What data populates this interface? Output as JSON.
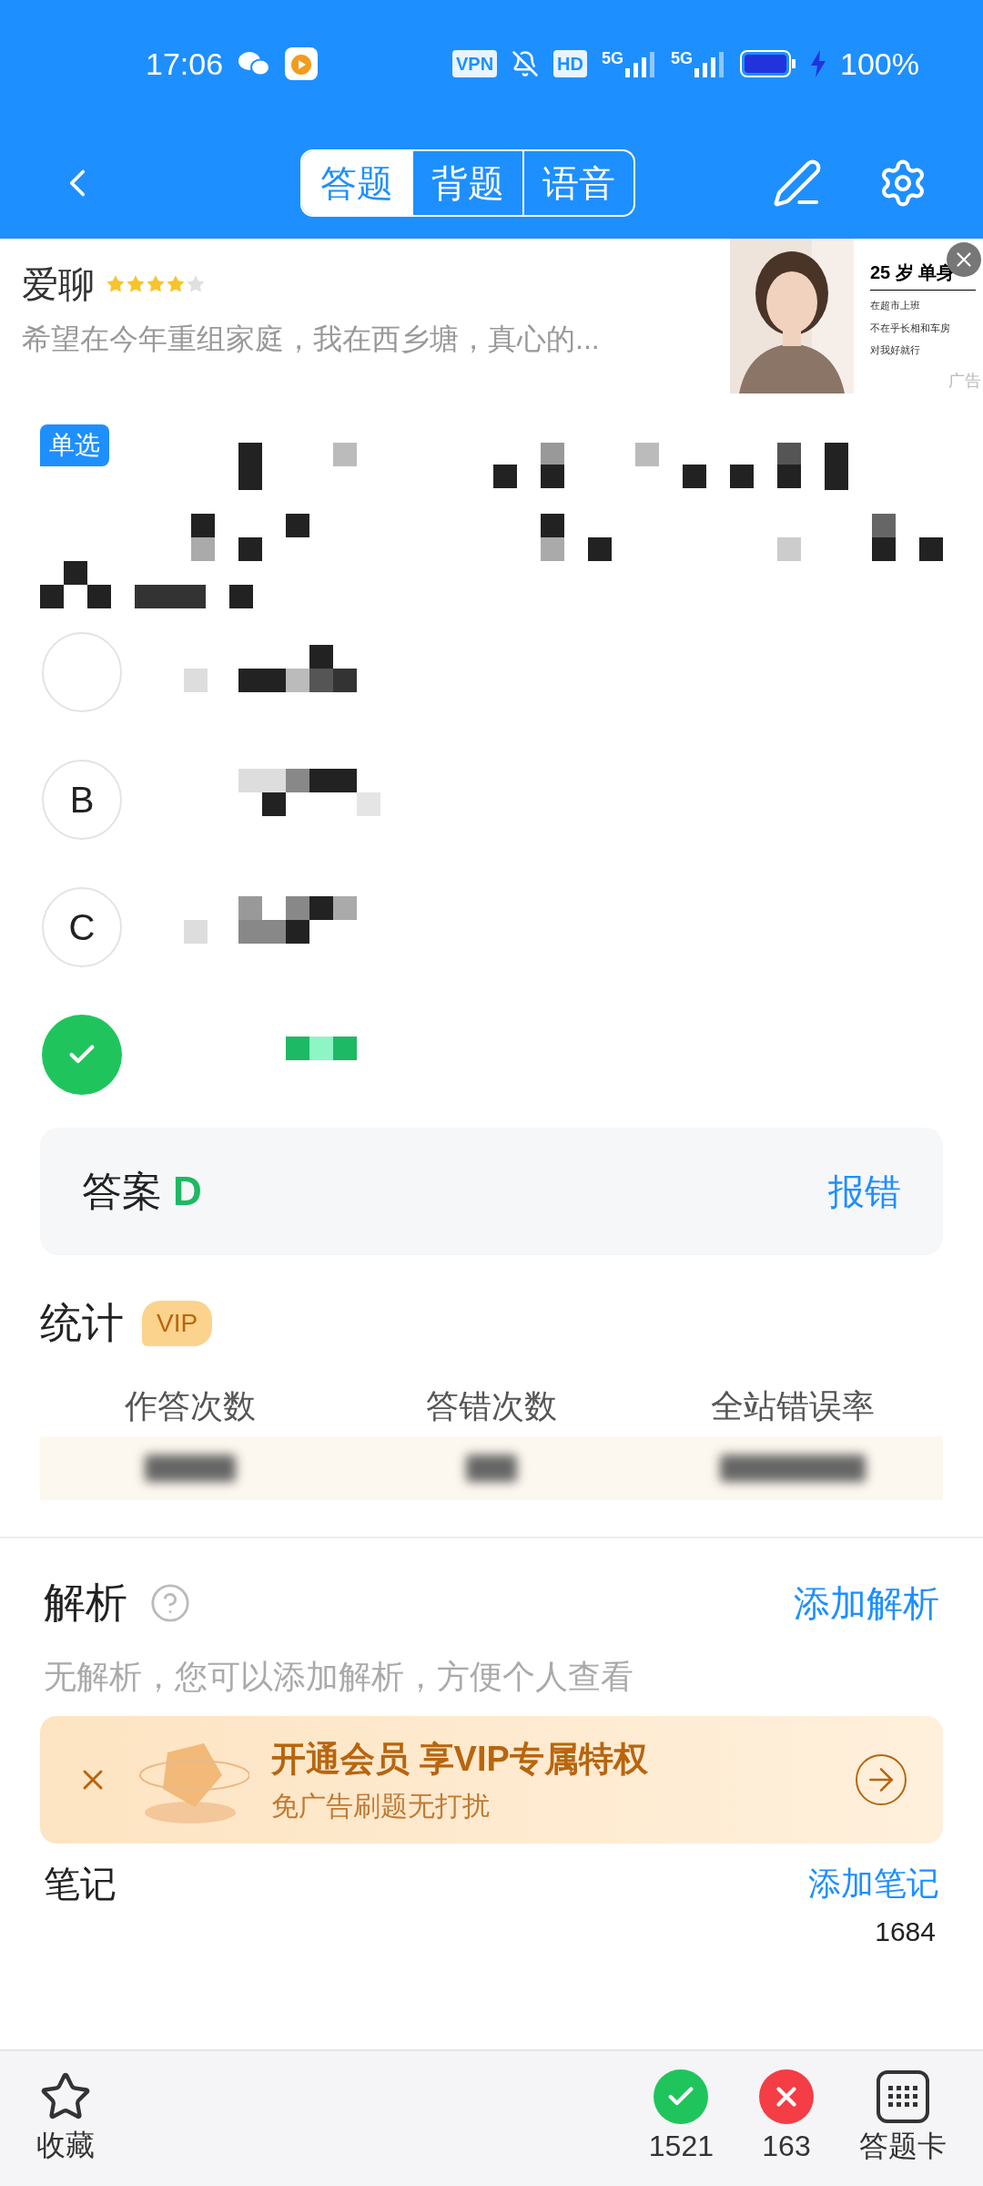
{
  "status_bar": {
    "time": "17:06",
    "vpn": "VPN",
    "hd": "HD",
    "networks": [
      "5G",
      "5G"
    ],
    "battery": "100%"
  },
  "nav": {
    "tabs": [
      {
        "label": "答题",
        "selected": true
      },
      {
        "label": "背题",
        "selected": false
      },
      {
        "label": "语音",
        "selected": false
      }
    ]
  },
  "ad": {
    "app_name": "爱聊",
    "stars": 4,
    "description": "希望在今年重组家庭，我在西乡塘，真心的...",
    "headline": "25 岁 单身",
    "lines": [
      "在超市上班",
      "不在乎长相和车房",
      "对我好就行"
    ],
    "ad_label": "广告"
  },
  "question": {
    "type_badge": "单选"
  },
  "options": [
    {
      "kind": "plain"
    },
    {
      "letter": "B",
      "kind": "plain"
    },
    {
      "letter": "C",
      "kind": "plain"
    },
    {
      "kind": "correct"
    }
  ],
  "answer": {
    "label": "答案",
    "value": "D",
    "report": "报错"
  },
  "stats": {
    "title": "统计",
    "badge": "VIP",
    "columns": [
      "作答次数",
      "答错次数",
      "全站错误率"
    ]
  },
  "analysis": {
    "title": "解析",
    "add": "添加解析",
    "text": "无解析，您可以添加解析，方便个人查看"
  },
  "vip_banner": {
    "title": "开通会员 享VIP专属特权",
    "subtitle": "免广告刷题无打扰"
  },
  "notes": {
    "title": "笔记",
    "add": "添加笔记",
    "total": "1684"
  },
  "bottom_bar": {
    "favorite": "收藏",
    "correct_count": "1521",
    "wrong_count": "163",
    "card": "答题卡"
  }
}
